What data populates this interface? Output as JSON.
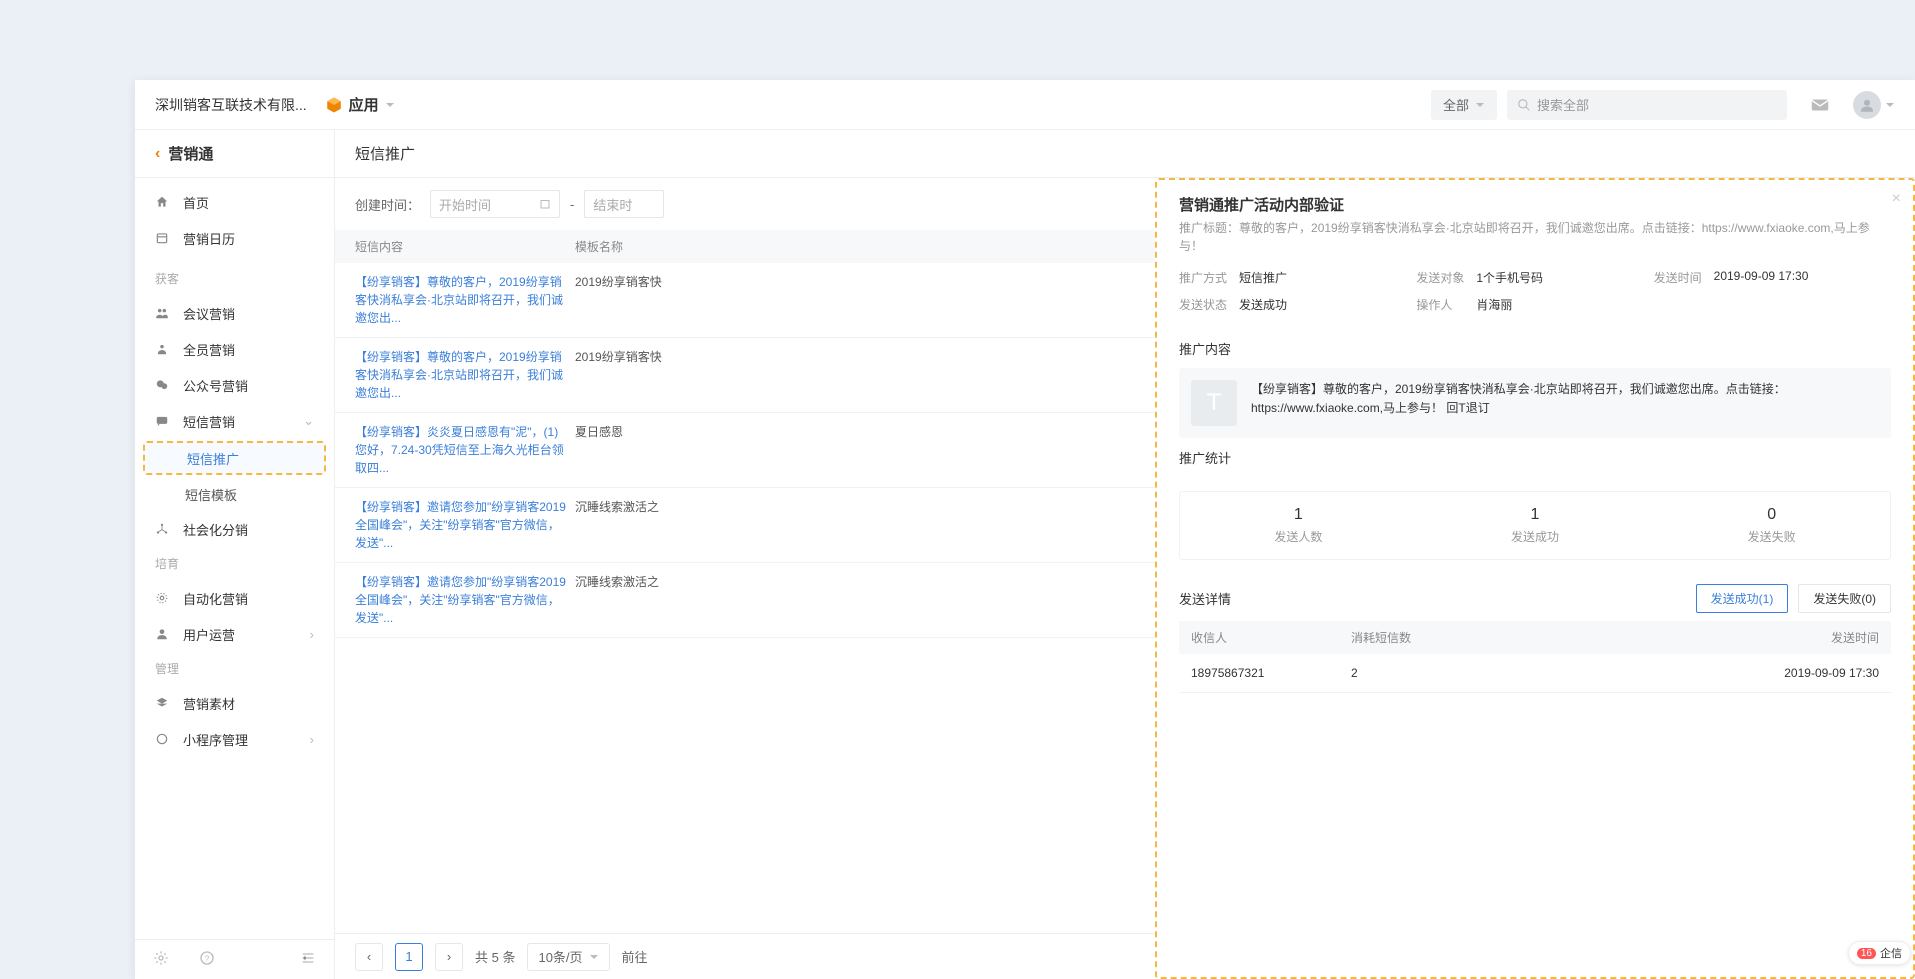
{
  "header": {
    "org": "深圳销客互联技术有限...",
    "appLabel": "应用",
    "filterAll": "全部",
    "searchPlaceholder": "搜索全部"
  },
  "sidebar": {
    "title": "营销通",
    "groups": {
      "nav": [
        {
          "key": "home",
          "label": "首页"
        },
        {
          "key": "calendar",
          "label": "营销日历"
        }
      ],
      "acquireLabel": "获客",
      "acquire": [
        {
          "key": "meeting",
          "label": "会议营销"
        },
        {
          "key": "allstaff",
          "label": "全员营销"
        },
        {
          "key": "wechatmp",
          "label": "公众号营销"
        },
        {
          "key": "sms",
          "label": "短信营销",
          "expandable": true,
          "children": [
            {
              "key": "smspush",
              "label": "短信推广",
              "active": true
            },
            {
              "key": "smstpl",
              "label": "短信模板"
            }
          ]
        },
        {
          "key": "social",
          "label": "社会化分销"
        }
      ],
      "nurtureLabel": "培育",
      "nurture": [
        {
          "key": "automation",
          "label": "自动化营销"
        },
        {
          "key": "userops",
          "label": "用户运营",
          "expandable": true
        }
      ],
      "manageLabel": "管理",
      "manage": [
        {
          "key": "assets",
          "label": "营销素材"
        },
        {
          "key": "miniprog",
          "label": "小程序管理",
          "expandable": true
        }
      ]
    }
  },
  "main": {
    "title": "短信推广",
    "filters": {
      "createdLabel": "创建时间：",
      "startPlaceholder": "开始时间",
      "endPlaceholder": "结束时"
    },
    "tableHeaders": {
      "content": "短信内容",
      "template": "模板名称"
    },
    "rows": [
      {
        "content": "【纷享销客】尊敬的客户，2019纷享销客快消私享会·北京站即将召开，我们诚邀您出...",
        "template": "2019纷享销客快"
      },
      {
        "content": "【纷享销客】尊敬的客户，2019纷享销客快消私享会·北京站即将召开，我们诚邀您出...",
        "template": "2019纷享销客快"
      },
      {
        "content": "【纷享销客】炎炎夏日感恩有\"泥\"，(1) 您好，7.24-30凭短信至上海久光柜台领取四...",
        "template": "夏日感恩"
      },
      {
        "content": "【纷享销客】邀请您参加\"纷享销客2019全国峰会\"，关注\"纷享销客\"官方微信，发送\"...",
        "template": "沉睡线索激活之"
      },
      {
        "content": "【纷享销客】邀请您参加\"纷享销客2019全国峰会\"，关注\"纷享销客\"官方微信，发送\"...",
        "template": "沉睡线索激活之"
      }
    ],
    "pager": {
      "total": "共 5 条",
      "pageSize": "10条/页",
      "current": "1",
      "goto": "前往"
    }
  },
  "drawer": {
    "title": "营销通推广活动内部验证",
    "subtitlePrefix": "推广标题：",
    "subtitleBody": "尊敬的客户，2019纷享销客快消私享会·北京站即将召开，我们诚邀您出席。点击链接：https://www.fxiaoke.com,马上参与！",
    "info": {
      "method": {
        "label": "推广方式",
        "value": "短信推广"
      },
      "target": {
        "label": "发送对象",
        "value": "1个手机号码"
      },
      "time": {
        "label": "发送时间",
        "value": "2019-09-09 17:30"
      },
      "status": {
        "label": "发送状态",
        "value": "发送成功"
      },
      "operator": {
        "label": "操作人",
        "value": "肖海丽"
      }
    },
    "contentSection": "推广内容",
    "promoText": "【纷享销客】尊敬的客户，2019纷享销客快消私享会·北京站即将召开，我们诚邀您出席。点击链接：https://www.fxiaoke.com,马上参与！ 回T退订",
    "statsSection": "推广统计",
    "stats": [
      {
        "value": "1",
        "label": "发送人数"
      },
      {
        "value": "1",
        "label": "发送成功"
      },
      {
        "value": "0",
        "label": "发送失败"
      }
    ],
    "detailSection": "发送详情",
    "tabs": {
      "success": "发送成功(1)",
      "fail": "发送失败(0)"
    },
    "detailHeaders": {
      "recipient": "收信人",
      "consumed": "消耗短信数",
      "sendTime": "发送时间"
    },
    "detailRows": [
      {
        "recipient": "18975867321",
        "consumed": "2",
        "sendTime": "2019-09-09 17:30"
      }
    ]
  },
  "corner": {
    "count": "16",
    "label": "企信"
  }
}
